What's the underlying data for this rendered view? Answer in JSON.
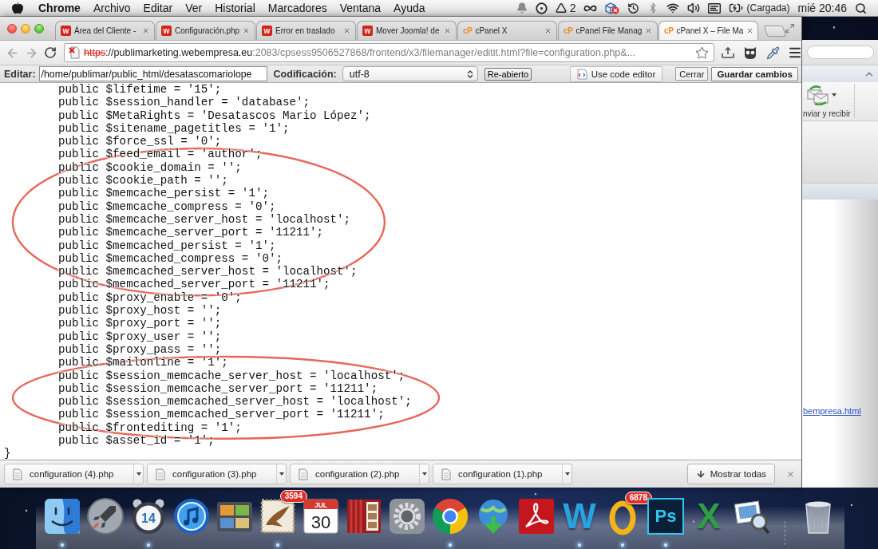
{
  "menu_bar": {
    "app_name": "Chrome",
    "menus": [
      "Archivo",
      "Editar",
      "Ver",
      "Historial",
      "Marcadores",
      "Ventana",
      "Ayuda"
    ],
    "status_count": "2",
    "battery_label": "(Cargada)",
    "clock": "mié 20:46"
  },
  "tabs": [
    {
      "label": "Área del Cliente -",
      "favicon": {
        "kind": "tile",
        "text": "w",
        "color": "#d3261b"
      },
      "selected": false
    },
    {
      "label": "Configuración.php",
      "favicon": {
        "kind": "tile",
        "text": "w",
        "color": "#d3261b"
      },
      "selected": false
    },
    {
      "label": "Error en traslado",
      "favicon": {
        "kind": "tile",
        "text": "w",
        "color": "#d3261b"
      },
      "selected": false
    },
    {
      "label": "Mover Joomla! de",
      "favicon": {
        "kind": "tile",
        "text": "w",
        "color": "#d3261b"
      },
      "selected": false
    },
    {
      "label": "cPanel X",
      "favicon": {
        "kind": "text",
        "text": "cP",
        "color": "#f08a1c"
      },
      "selected": false
    },
    {
      "label": "cPanel File Manag",
      "favicon": {
        "kind": "text",
        "text": "cP",
        "color": "#f08a1c"
      },
      "selected": false
    },
    {
      "label": "cPanel X – File Ma",
      "favicon": {
        "kind": "text",
        "text": "cP",
        "color": "#f08a1c"
      },
      "selected": true
    }
  ],
  "toolbar": {
    "back": {
      "disabled": true
    },
    "forward": {
      "disabled": true
    },
    "url": {
      "certificate_error": true,
      "scheme": "https",
      "host": "://publimarketing.webempresa.eu",
      "rest": ":2083/cpsess9506527868/frontend/x3/filemanager/editit.html?file=configuration.php&..."
    }
  },
  "editor_bar": {
    "path_label": "Editar:",
    "path_value": "/home/publimar/public_html/desatascomariolope",
    "encoding_label": "Codificación:",
    "encoding_value": "utf-8",
    "reopen_button": "Re-abierto",
    "actions": [
      {
        "kind": "icon",
        "label": "Use code editor"
      },
      {
        "kind": "plain",
        "label": "Cerrar"
      },
      {
        "kind": "primary",
        "label": "Guardar cambios"
      }
    ]
  },
  "code": {
    "groups": [
      {
        "circled": false,
        "lines": [
          "public $lifetime = '15';",
          "public $session_handler = 'database';",
          "public $MetaRights = 'Desatascos Mario López';",
          "public $sitename_pagetitles = '1';",
          "public $force_ssl = '0';"
        ]
      },
      {
        "circled": true,
        "lines": [
          "public $feed_email = 'author';",
          "public $cookie_domain = '';",
          "public $cookie_path = '';",
          "public $memcache_persist = '1';",
          "public $memcache_compress = '0';",
          "public $memcache_server_host = 'localhost';",
          "public $memcache_server_port = '11211';",
          "public $memcached_persist = '1';",
          "public $memcached_compress = '0';",
          "public $memcached_server_host = 'localhost';",
          "public $memcached_server_port = '11211';"
        ]
      },
      {
        "circled": false,
        "lines": [
          "public $proxy_enable = '0';",
          "public $proxy_host = '';",
          "public $proxy_port = '';",
          "public $proxy_user = '';",
          "public $proxy_pass = '';"
        ]
      },
      {
        "circled": true,
        "lines": [
          "public $mailonline = '1';",
          "public $session_memcache_server_host = 'localhost';",
          "public $session_memcache_server_port = '11211';",
          "public $session_memcached_server_host = 'localhost';",
          "public $session_memcached_server_port = '11211';",
          "public $frontediting = '1';"
        ]
      },
      {
        "circled": false,
        "lines": [
          "public $asset_id = '1';"
        ]
      }
    ],
    "closing": "}"
  },
  "downloads": {
    "files": [
      "configuration (4).php",
      "configuration (3).php",
      "configuration (2).php",
      "configuration (1).php"
    ],
    "show_all": "Mostrar todas"
  },
  "background_window": {
    "ribbon_label": "nviar y recibir",
    "link": "bempresa.html"
  },
  "dock": [
    {
      "kind": "face",
      "running": true
    },
    {
      "kind": "rocket",
      "running": false
    },
    {
      "kind": "clock",
      "text": "14",
      "running": true
    },
    {
      "kind": "note",
      "running": false
    },
    {
      "kind": "album",
      "running": false
    },
    {
      "kind": "stamp",
      "badge": "3594",
      "running": true
    },
    {
      "kind": "calendar",
      "month": "JUL",
      "text": "30",
      "running": false
    },
    {
      "kind": "curtain",
      "running": false
    },
    {
      "kind": "gear",
      "running": false
    },
    {
      "kind": "wheel",
      "running": true
    },
    {
      "kind": "globe",
      "running": false
    },
    {
      "kind": "swirl",
      "running": false
    },
    {
      "kind": "letter",
      "text": "W",
      "color": "#29a3e0",
      "running": true
    },
    {
      "kind": "ring",
      "badge": "6878",
      "running": true
    },
    {
      "kind": "tile",
      "text": "Ps",
      "color": "#31c5f0",
      "running": true
    },
    {
      "kind": "letter",
      "text": "X",
      "color": "#2f9e44",
      "running": false
    },
    {
      "kind": "loupe",
      "running": false
    },
    {
      "kind": "trash",
      "running": false
    }
  ]
}
